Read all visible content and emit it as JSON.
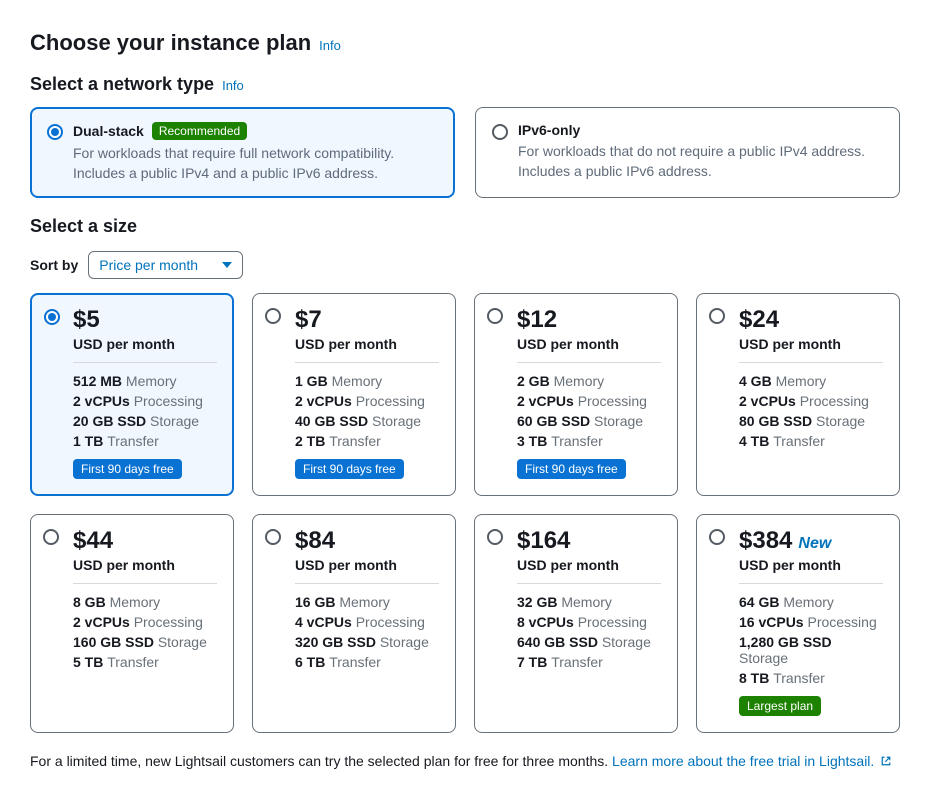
{
  "headings": {
    "choose_plan": "Choose your instance plan",
    "info": "Info",
    "select_network": "Select a network type",
    "select_size": "Select a size"
  },
  "network_options": [
    {
      "title": "Dual-stack",
      "badge": "Recommended",
      "desc": "For workloads that require full network compatibility. Includes a public IPv4 and a public IPv6 address.",
      "selected": true
    },
    {
      "title": "IPv6-only",
      "badge": "",
      "desc": "For workloads that do not require a public IPv4 address. Includes a public IPv6 address.",
      "selected": false
    }
  ],
  "sort": {
    "label": "Sort by",
    "value": "Price per month"
  },
  "labels": {
    "per_month": "USD per month",
    "memory": "Memory",
    "processing": "Processing",
    "storage": "Storage",
    "transfer": "Transfer"
  },
  "plans": [
    {
      "price": "$5",
      "memory": "512 MB",
      "cpu": "2 vCPUs",
      "storage": "20 GB SSD",
      "transfer": "1 TB",
      "badge": "First 90 days free",
      "badge_kind": "blue",
      "selected": true,
      "new": false
    },
    {
      "price": "$7",
      "memory": "1 GB",
      "cpu": "2 vCPUs",
      "storage": "40 GB SSD",
      "transfer": "2 TB",
      "badge": "First 90 days free",
      "badge_kind": "blue",
      "selected": false,
      "new": false
    },
    {
      "price": "$12",
      "memory": "2 GB",
      "cpu": "2 vCPUs",
      "storage": "60 GB SSD",
      "transfer": "3 TB",
      "badge": "First 90 days free",
      "badge_kind": "blue",
      "selected": false,
      "new": false
    },
    {
      "price": "$24",
      "memory": "4 GB",
      "cpu": "2 vCPUs",
      "storage": "80 GB SSD",
      "transfer": "4 TB",
      "badge": "",
      "badge_kind": "",
      "selected": false,
      "new": false
    },
    {
      "price": "$44",
      "memory": "8 GB",
      "cpu": "2 vCPUs",
      "storage": "160 GB SSD",
      "transfer": "5 TB",
      "badge": "",
      "badge_kind": "",
      "selected": false,
      "new": false
    },
    {
      "price": "$84",
      "memory": "16 GB",
      "cpu": "4 vCPUs",
      "storage": "320 GB SSD",
      "transfer": "6 TB",
      "badge": "",
      "badge_kind": "",
      "selected": false,
      "new": false
    },
    {
      "price": "$164",
      "memory": "32 GB",
      "cpu": "8 vCPUs",
      "storage": "640 GB SSD",
      "transfer": "7 TB",
      "badge": "",
      "badge_kind": "",
      "selected": false,
      "new": false
    },
    {
      "price": "$384",
      "memory": "64 GB",
      "cpu": "16 vCPUs",
      "storage": "1,280 GB SSD",
      "transfer": "8 TB",
      "badge": "Largest plan",
      "badge_kind": "green",
      "selected": false,
      "new": true
    }
  ],
  "new_label": "New",
  "footnote": {
    "text": "For a limited time, new Lightsail customers can try the selected plan for free for three months. ",
    "link": "Learn more about the free trial in Lightsail."
  }
}
